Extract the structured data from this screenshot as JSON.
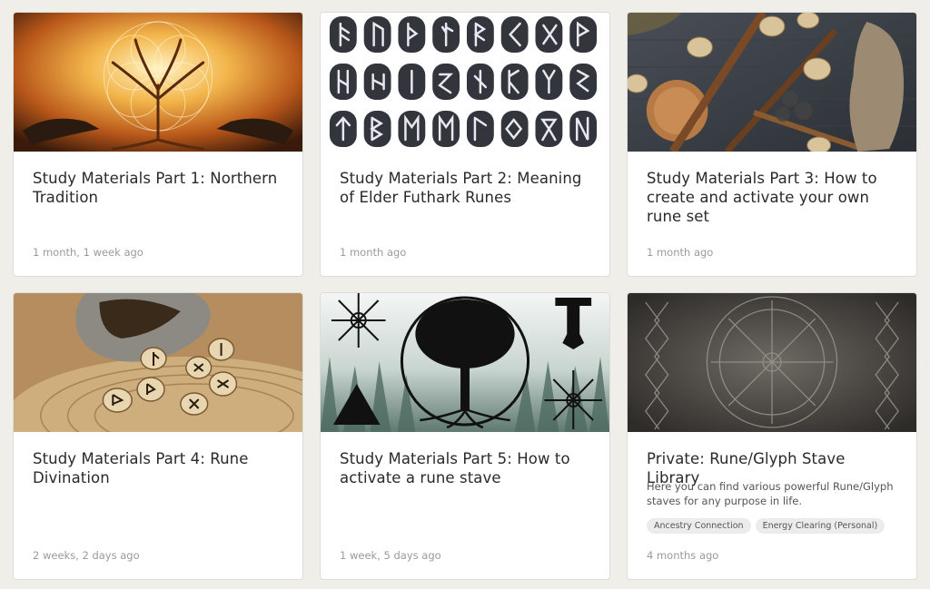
{
  "cards": [
    {
      "title": "Study Materials Part 1: Northern Tradition",
      "date": "1 month, 1 week ago",
      "image": "tree-of-life-ravens-image"
    },
    {
      "title": "Study Materials Part 2: Meaning of Elder Futhark Runes",
      "date": "1 month ago",
      "image": "rune-stones-grid-image"
    },
    {
      "title": "Study Materials Part 3: How to create and activate your own rune set",
      "date": "1 month ago",
      "image": "wooden-runes-tools-image"
    },
    {
      "title": "Study Materials Part 4: Rune Divination",
      "date": "2 weeks, 2 days ago",
      "image": "rune-pouch-divination-image"
    },
    {
      "title": "Study Materials Part 5: How to activate a rune stave",
      "date": "1 week, 5 days ago",
      "image": "norse-symbols-forest-image"
    },
    {
      "title": "Private: Rune/Glyph Stave Library",
      "description": "Here you can find various powerful Rune/Glyph staves for any purpose in life.",
      "tags": [
        "Ancestry Connection",
        "Energy Clearing (Personal)"
      ],
      "date": "4 months ago",
      "image": "stone-carved-stave-image"
    }
  ],
  "colors": {
    "background": "#efeee9",
    "card": "#ffffff",
    "title": "#2a2a2a",
    "meta": "#9a9a9a"
  }
}
